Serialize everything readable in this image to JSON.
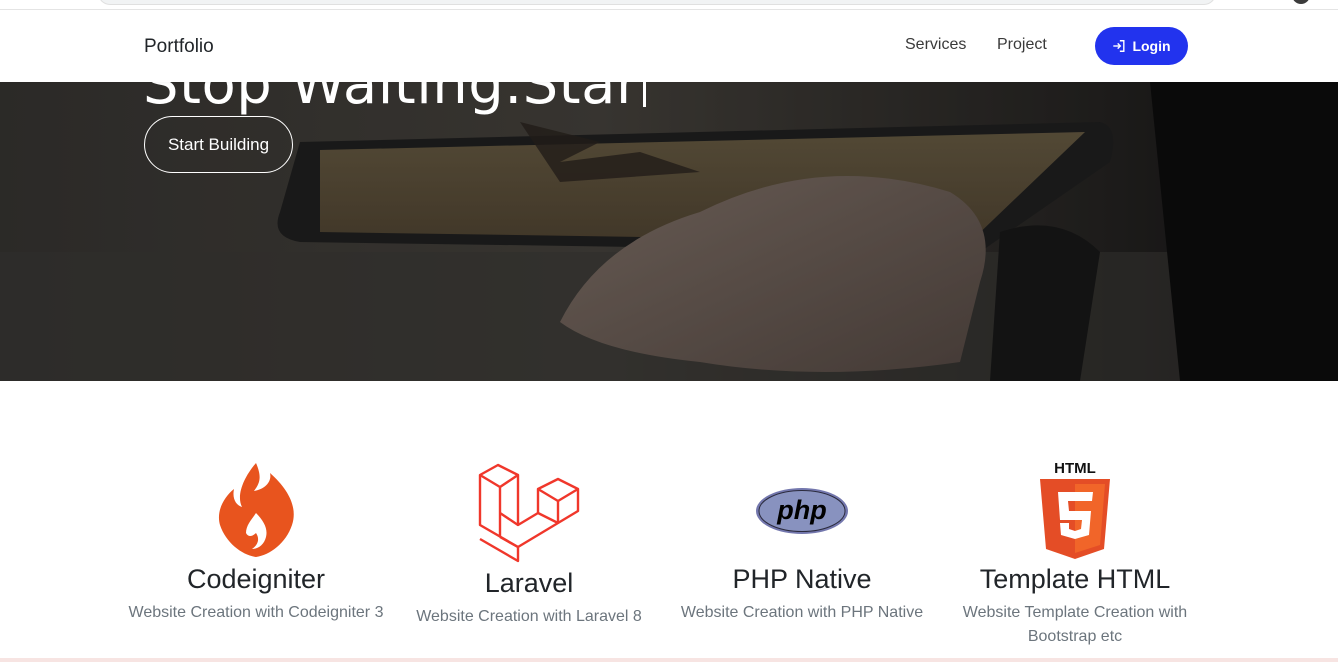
{
  "navbar": {
    "brand": "Portfolio",
    "links": [
      "Services",
      "Project"
    ],
    "login_label": "Login",
    "accent_color": "#2233ee"
  },
  "hero": {
    "title": "Stop Waiting.Star",
    "cta_label": "Start Building"
  },
  "services": [
    {
      "title": "Codeigniter",
      "description": "Website Creation with Codeigniter 3",
      "icon": "codeigniter-flame-icon",
      "color": "#e8541e"
    },
    {
      "title": "Laravel",
      "description": "Website Creation with Laravel 8",
      "icon": "laravel-icon",
      "color": "#f0372b"
    },
    {
      "title": "PHP Native",
      "description": "Website Creation with PHP Native",
      "icon": "php-icon",
      "color": "#7377ad"
    },
    {
      "title": "Template HTML",
      "description": "Website Template Creation with Bootstrap etc",
      "icon": "html5-icon",
      "color": "#e44d26"
    }
  ]
}
